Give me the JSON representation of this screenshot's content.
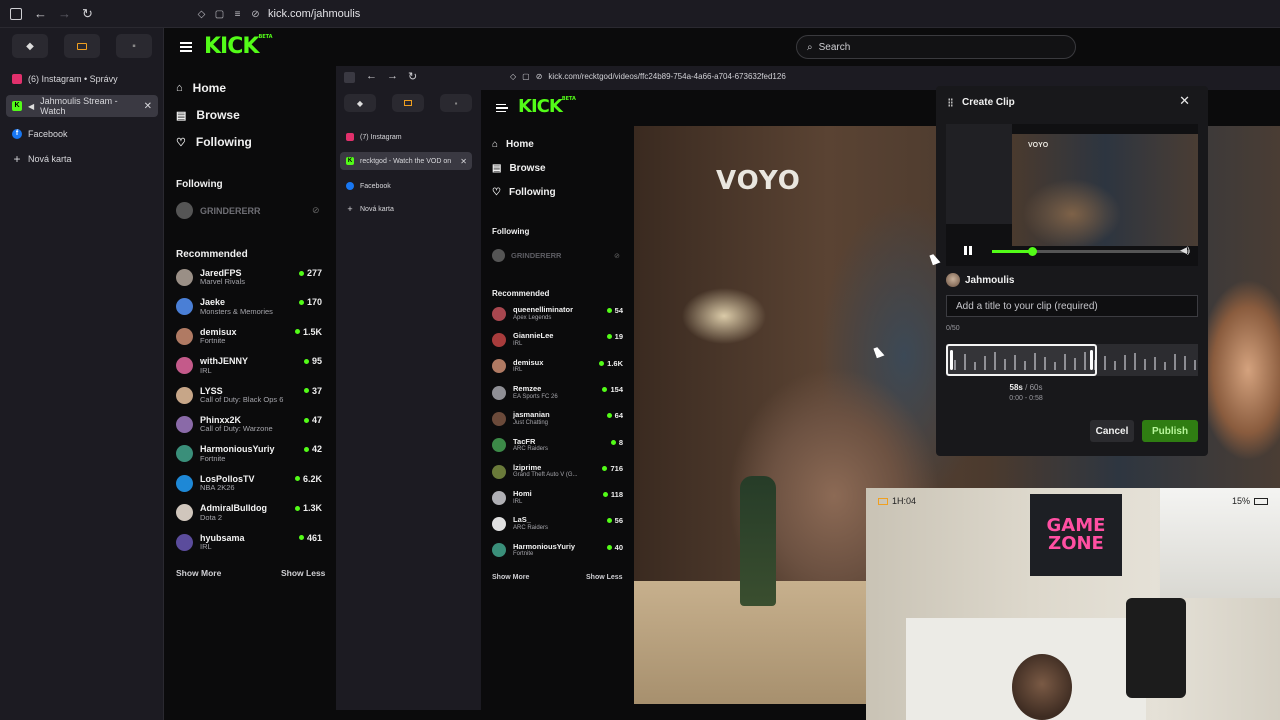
{
  "outer_browser": {
    "url": "kick.com/jahmoulis",
    "tabs": [
      {
        "label": "(6) Instagram • Správy",
        "favicon_color": "#e1306c",
        "active": false
      },
      {
        "label": "Jahmoulis Stream - Watch",
        "favicon_color": "#53fc18",
        "active": true
      },
      {
        "label": "Facebook",
        "favicon_color": "#1877f2",
        "active": false
      },
      {
        "label": "Nová karta",
        "favicon_color": "",
        "active": false
      }
    ]
  },
  "kick": {
    "search_placeholder": "Search",
    "nav": [
      {
        "label": "Home",
        "icon": "home-icon"
      },
      {
        "label": "Browse",
        "icon": "browse-icon"
      },
      {
        "label": "Following",
        "icon": "heart-icon"
      }
    ],
    "following_title": "Following",
    "following": [
      {
        "name": "GRINDERERR"
      }
    ],
    "recommended_title": "Recommended",
    "recommended": [
      {
        "name": "JaredFPS",
        "game": "Marvel Rivals",
        "viewers": "277",
        "avatar_color": "#9a8f86"
      },
      {
        "name": "Jaeke",
        "game": "Monsters & Memories",
        "viewers": "170",
        "avatar_color": "#4a7fd6"
      },
      {
        "name": "demisux",
        "game": "Fortnite",
        "viewers": "1.5K",
        "avatar_color": "#b07a63"
      },
      {
        "name": "withJENNY",
        "game": "IRL",
        "viewers": "95",
        "avatar_color": "#c45a8a"
      },
      {
        "name": "LYSS",
        "game": "Call of Duty: Black Ops 6",
        "viewers": "37",
        "avatar_color": "#c7a688"
      },
      {
        "name": "Phinxx2K",
        "game": "Call of Duty: Warzone",
        "viewers": "47",
        "avatar_color": "#8a6aa8"
      },
      {
        "name": "HarmoniousYuriy",
        "game": "Fortnite",
        "viewers": "42",
        "avatar_color": "#3a8f7a"
      },
      {
        "name": "LosPollosTV",
        "game": "NBA 2K26",
        "viewers": "6.2K",
        "avatar_color": "#1e88d6"
      },
      {
        "name": "AdmiralBulldog",
        "game": "Dota 2",
        "viewers": "1.3K",
        "avatar_color": "#d0c6bc"
      },
      {
        "name": "hyubsama",
        "game": "IRL",
        "viewers": "461",
        "avatar_color": "#5b4c9c"
      }
    ],
    "show_more": "Show More",
    "show_less": "Show Less"
  },
  "inner_browser": {
    "url": "kick.com/recktgod/videos/ffc24b89-754a-4a66-a704-673632fed126",
    "tabs": [
      {
        "label": "(7) Instagram",
        "favicon_color": "#e1306c",
        "active": false
      },
      {
        "label": "recktgod - Watch the VOD on",
        "favicon_color": "#53fc18",
        "active": true
      },
      {
        "label": "Facebook",
        "favicon_color": "#1877f2",
        "active": false
      },
      {
        "label": "Nová karta",
        "favicon_color": "",
        "active": false
      }
    ],
    "kick": {
      "nav": [
        {
          "label": "Home",
          "icon": "home-icon"
        },
        {
          "label": "Browse",
          "icon": "browse-icon"
        },
        {
          "label": "Following",
          "icon": "heart-icon"
        }
      ],
      "following_title": "Following",
      "following": [
        {
          "name": "GRINDERERR"
        }
      ],
      "recommended_title": "Recommended",
      "recommended": [
        {
          "name": "queenelliminator",
          "game": "Apex Legends",
          "viewers": "54",
          "avatar_color": "#a8474f"
        },
        {
          "name": "GiannieLee",
          "game": "IRL",
          "viewers": "19",
          "avatar_color": "#a83c3c"
        },
        {
          "name": "demisux",
          "game": "IRL",
          "viewers": "1.6K",
          "avatar_color": "#b07a63"
        },
        {
          "name": "Remzee",
          "game": "EA Sports FC 26",
          "viewers": "154",
          "avatar_color": "#8f8f95"
        },
        {
          "name": "jasmanian",
          "game": "Just Chatting",
          "viewers": "64",
          "avatar_color": "#6b4a3a"
        },
        {
          "name": "TacFR",
          "game": "ARC Raiders",
          "viewers": "8",
          "avatar_color": "#3c8a48"
        },
        {
          "name": "lziprime",
          "game": "Grand Theft Auto V (G...",
          "viewers": "716",
          "avatar_color": "#6a7a3a"
        },
        {
          "name": "Homi",
          "game": "IRL",
          "viewers": "118",
          "avatar_color": "#b0b0b5"
        },
        {
          "name": "LaS_",
          "game": "ARC Raiders",
          "viewers": "56",
          "avatar_color": "#e0e0e0"
        },
        {
          "name": "HarmoniousYuriy",
          "game": "Fortnite",
          "viewers": "40",
          "avatar_color": "#3a8f7a"
        }
      ],
      "show_more": "Show More",
      "show_less": "Show Less"
    }
  },
  "video": {
    "watermark": "VOYO",
    "webcam_poster": "GAME ZONE",
    "recording_time": "1H:04",
    "battery": "15%"
  },
  "clip_modal": {
    "title": "Create Clip",
    "streamer": "Jahmoulis",
    "title_placeholder": "Add a title to your clip (required)",
    "char_count": "0/50",
    "duration_selected": "58s",
    "duration_max": "/ 60s",
    "range": "0:00 - 0:58",
    "cancel_label": "Cancel",
    "publish_label": "Publish",
    "preview_watermark": "VOYO",
    "playhead_fraction": 0.2,
    "selection_fraction": 0.6
  },
  "colors": {
    "kick_green": "#53fc18",
    "publish_bg": "#2f7d12"
  }
}
